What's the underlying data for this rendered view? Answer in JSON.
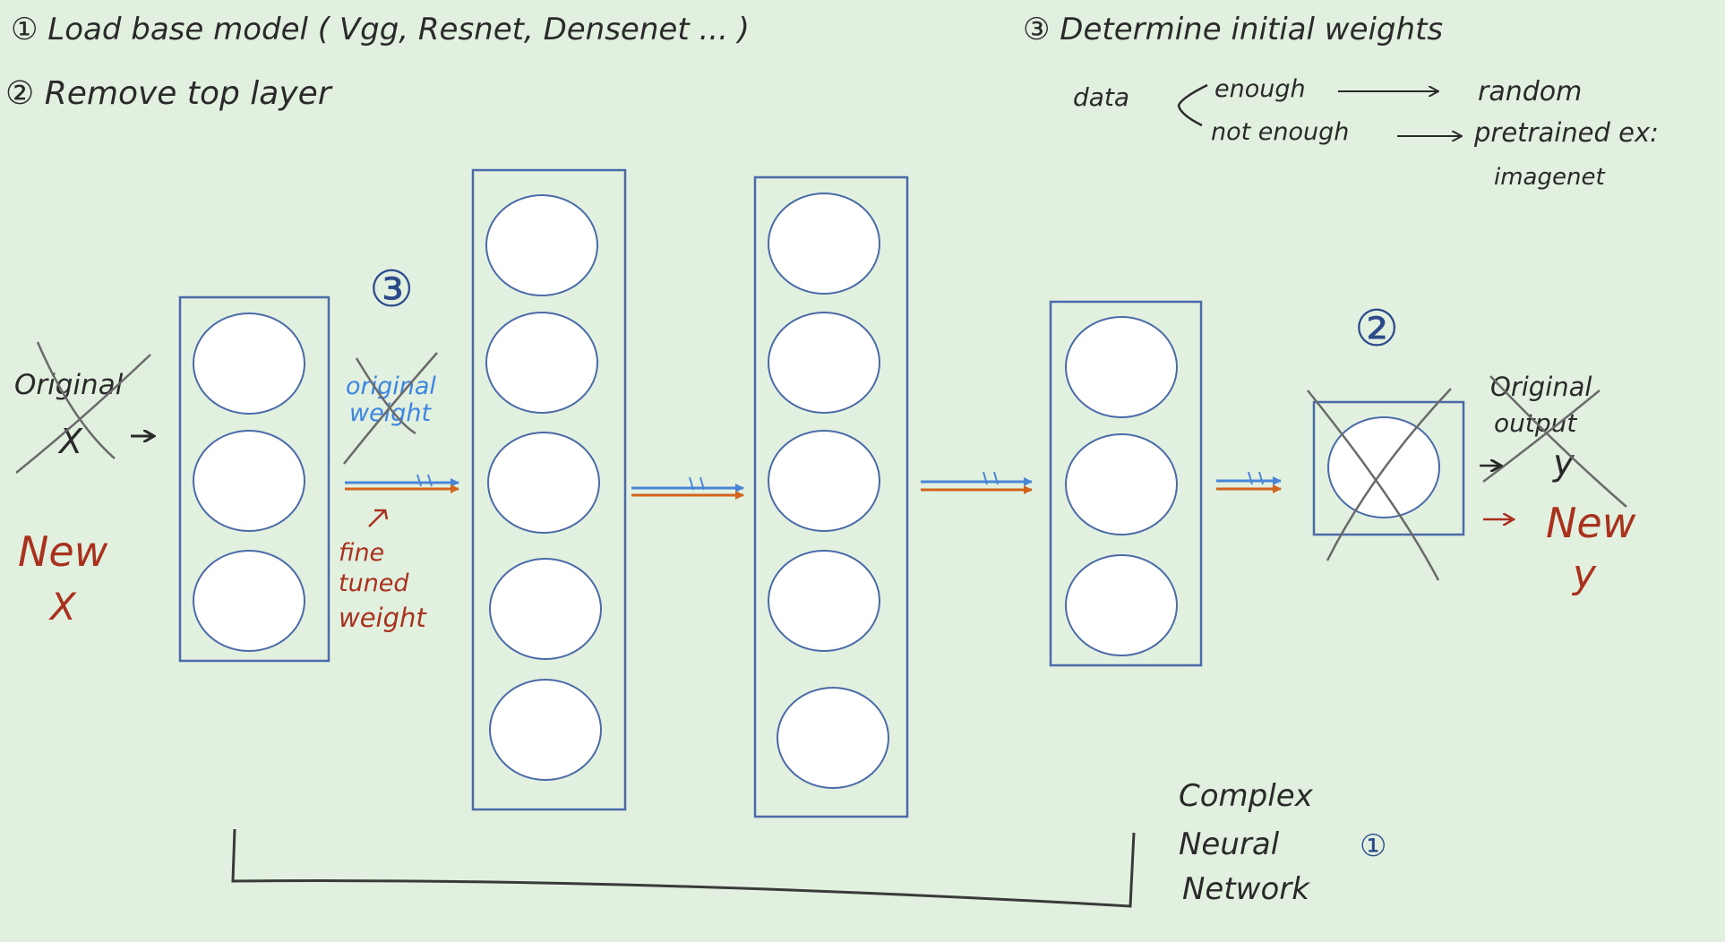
{
  "colors": {
    "background": "#e2f0e0",
    "ink": "#2a2a2a",
    "box": "#4a6aa8",
    "blue_arrow": "#4a86d8",
    "orange_arrow": "#d2641e",
    "red_ink": "#a8321e",
    "blue_ink": "#3d86e0",
    "cross": "#6a6a6a",
    "node_fill": "#ffffff"
  },
  "steps": {
    "step1": "① Load base model ( Vgg, Resnet, Densenet ... )",
    "step2": "② Remove top layer",
    "step3": "③ Determine initial weights"
  },
  "weights_branch": {
    "data_label": "data",
    "enough_label": "enough",
    "random_label": "random",
    "not_enough_label": "not enough",
    "pretrained_label": "pretrained ex:",
    "imagenet_label": "imagenet"
  },
  "input": {
    "original_label": "Original",
    "original_x": "X",
    "new_label": "New",
    "new_x": "X"
  },
  "weights_annotation": {
    "marker": "③",
    "original_line1": "original",
    "original_line2": "weight",
    "fine_line1": "fine",
    "fine_line2": "tuned",
    "fine_line3": "weight"
  },
  "output": {
    "marker": "②",
    "original_line1": "Original",
    "original_line2": "output",
    "original_y": "y",
    "new_label": "New",
    "new_y": "y"
  },
  "network": {
    "line1": "Complex",
    "line2": "Neural",
    "line3": "Network",
    "marker": "①"
  },
  "layers": [
    {
      "nodes": 3
    },
    {
      "nodes": 5
    },
    {
      "nodes": 5
    },
    {
      "nodes": 3
    },
    {
      "nodes": 1
    }
  ]
}
